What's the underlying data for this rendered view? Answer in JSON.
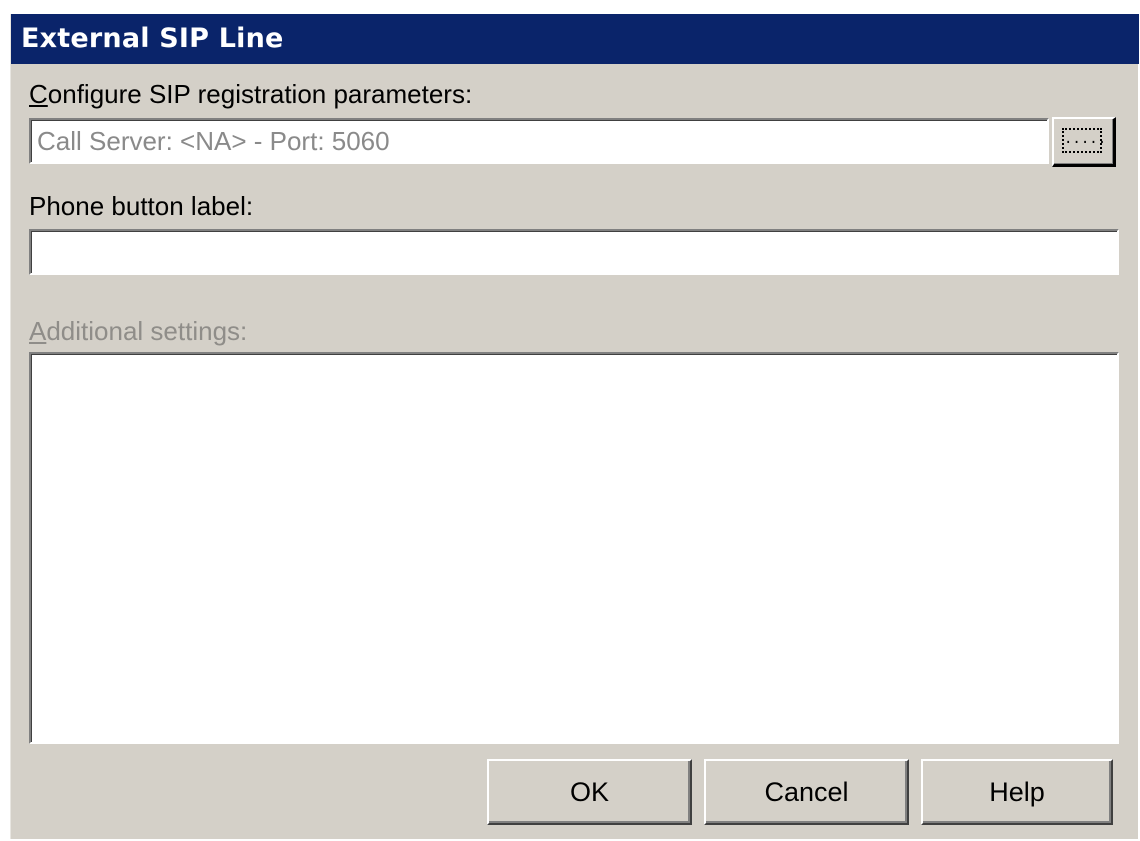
{
  "window": {
    "title": "External SIP Line"
  },
  "sip": {
    "label_mnemonic": "C",
    "label_rest": "onfigure SIP registration parameters:",
    "value": "Call Server: <NA> - Port: 5060",
    "browse_label": "....."
  },
  "phone": {
    "label": "Phone button label:",
    "value": ""
  },
  "additional": {
    "label_mnemonic": "A",
    "label_rest": "dditional settings:",
    "value": ""
  },
  "buttons": {
    "ok": "OK",
    "cancel": "Cancel",
    "help": "Help"
  }
}
